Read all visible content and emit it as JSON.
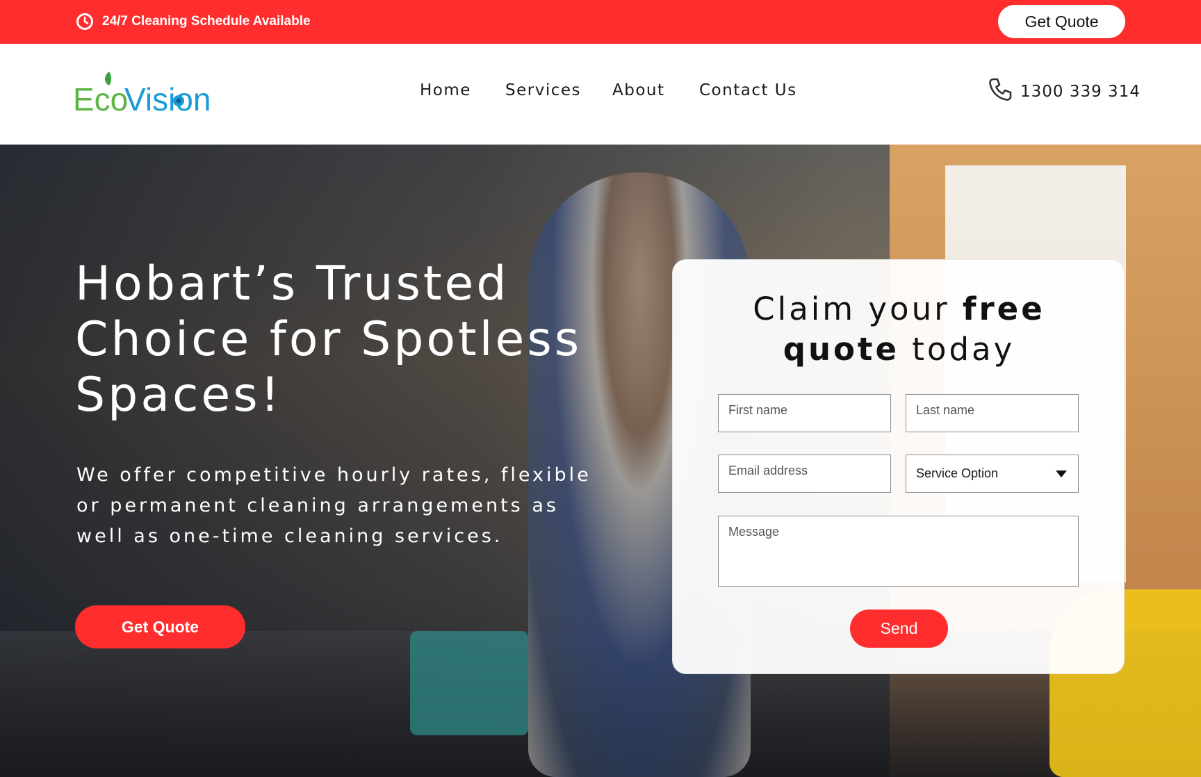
{
  "topbar": {
    "schedule_text": "24/7 Cleaning Schedule Available",
    "clock_icon": "clock-icon",
    "get_quote_label": "Get Quote",
    "background_color": "#ff2d2d"
  },
  "header": {
    "logo": {
      "part1": "Eco",
      "part2": "Vision"
    },
    "nav": [
      "Home",
      "Services",
      "About",
      "Contact Us"
    ],
    "phone_icon": "phone-icon",
    "phone_number": "1300 339 314"
  },
  "hero": {
    "title_lines": [
      "Hobart’s Trusted",
      "Choice for Spotless",
      "Spaces!"
    ],
    "subtitle_lines": [
      "We offer competitive hourly rates, flexible",
      "or permanent cleaning arrangements as",
      "well as one-time cleaning services."
    ],
    "cta_label": "Get Quote"
  },
  "form": {
    "title": {
      "part1": "Claim your ",
      "bold1": "free",
      "bold2": "quote",
      "part2": " today"
    },
    "first_name_placeholder": "First name",
    "last_name_placeholder": "Last name",
    "email_placeholder": "Email address",
    "service_select_value": "Service Option",
    "message_placeholder": "Message",
    "send_label": "Send"
  },
  "colors": {
    "accent": "#ff2d2d",
    "logo_green": "#5bb443",
    "logo_blue": "#1a9bd7"
  }
}
